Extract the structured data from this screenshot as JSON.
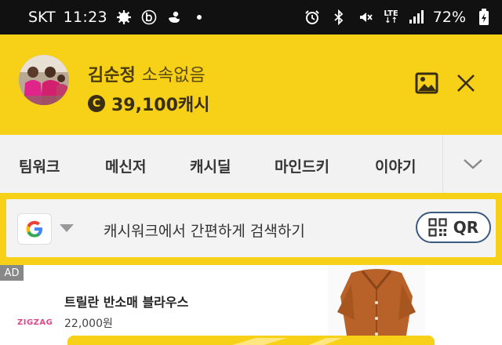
{
  "status_bar": {
    "carrier": "SKT",
    "time": "11:23",
    "network": "LTE",
    "battery": "72%"
  },
  "header": {
    "user_name": "김순정",
    "user_org": "소속없음",
    "coin_symbol": "C",
    "cash_amount": "39,100캐시"
  },
  "tabs": [
    {
      "label": "팀워크"
    },
    {
      "label": "메신저"
    },
    {
      "label": "캐시딜"
    },
    {
      "label": "마인드키"
    },
    {
      "label": "이야기"
    }
  ],
  "search": {
    "placeholder": "캐시워크에서 간편하게 검색하기",
    "qr_label": "QR"
  },
  "ad": {
    "badge": "AD",
    "brand": "ZIGZAG",
    "title": "트릴란 반소매 블라우스",
    "price": "22,000원"
  },
  "colors": {
    "brand_yellow": "#f7d117",
    "status_bar_bg": "#111111",
    "qr_border": "#3a5a80",
    "zigzag_pink": "#e0478a"
  }
}
